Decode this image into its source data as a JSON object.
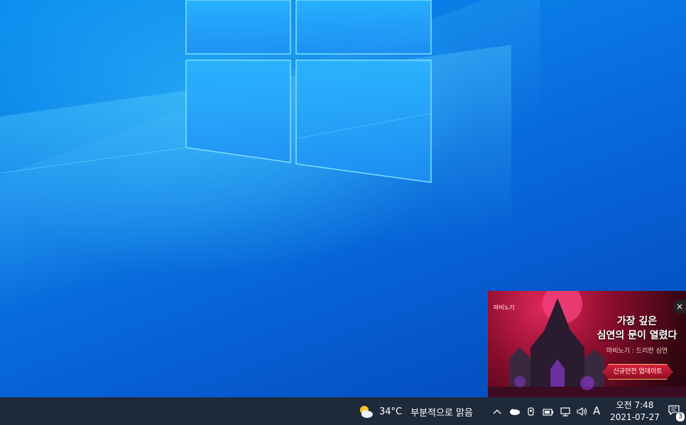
{
  "weather": {
    "icon": "partly-cloudy-icon",
    "temperature": "34°C",
    "description": "부분적으로 맑음"
  },
  "tray": {
    "icons": [
      "chevron-up-icon",
      "onedrive-cloud-icon",
      "meet-now-icon",
      "battery-icon",
      "network-icon",
      "volume-icon"
    ],
    "ime_label": "A"
  },
  "clock": {
    "time": "오전 7:48",
    "date": "2021-07-27"
  },
  "notifications": {
    "icon": "action-center-icon",
    "count": "3"
  },
  "ad": {
    "game_logo": "마비노기",
    "headline_1": "가장 깊은",
    "headline_2": "심연의 문이 열렸다",
    "subtitle": "마비노기 : 드리란 심연",
    "button_label": "신규던전 업데이트",
    "close_label": "×"
  },
  "colors": {
    "taskbar": "#1e2a3a",
    "desktop_accent": "#0a78e4",
    "ad_red": "#d8213b"
  }
}
